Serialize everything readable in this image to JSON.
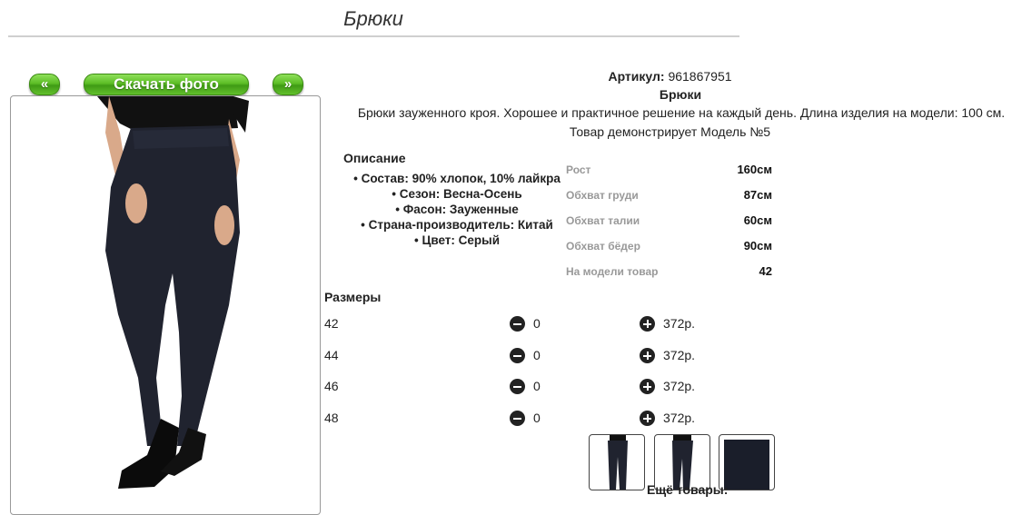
{
  "header": {
    "title": "Брюки"
  },
  "nav": {
    "prev_label": "«",
    "download_label": "Скачать фото",
    "next_label": "»"
  },
  "product": {
    "artikul_label": "Артикул:",
    "artikul_value": "961867951",
    "name": "Брюки",
    "description": "Брюки зауженного кроя. Хорошее и практичное решение на каждый день. Длина изделия на модели: 100 см.",
    "model_note": "Товар демонстрирует Модель №5"
  },
  "specs": {
    "title": "Описание",
    "items": [
      "Состав: 90% хлопок, 10% лайкра",
      "Сезон: Весна-Осень",
      "Фасон: Зауженные",
      "Страна-производитель: Китай",
      "Цвет: Серый"
    ]
  },
  "model": {
    "rows": [
      {
        "label": "Рост",
        "value": "160см"
      },
      {
        "label": "Обхват груди",
        "value": "87см"
      },
      {
        "label": "Обхват талии",
        "value": "60см"
      },
      {
        "label": "Обхват бёдер",
        "value": "90см"
      },
      {
        "label": "На модели товар",
        "value": "42"
      }
    ]
  },
  "sizes": {
    "title": "Размеры",
    "rows": [
      {
        "size": "42",
        "qty": "0",
        "price": "372р."
      },
      {
        "size": "44",
        "qty": "0",
        "price": "372р."
      },
      {
        "size": "46",
        "qty": "0",
        "price": "372р."
      },
      {
        "size": "48",
        "qty": "0",
        "price": "372р."
      }
    ]
  },
  "more": {
    "label": "Ещё товары:"
  },
  "colors": {
    "accent_green": "#5cbd26",
    "garment": "#1f2230",
    "border": "#999999"
  }
}
